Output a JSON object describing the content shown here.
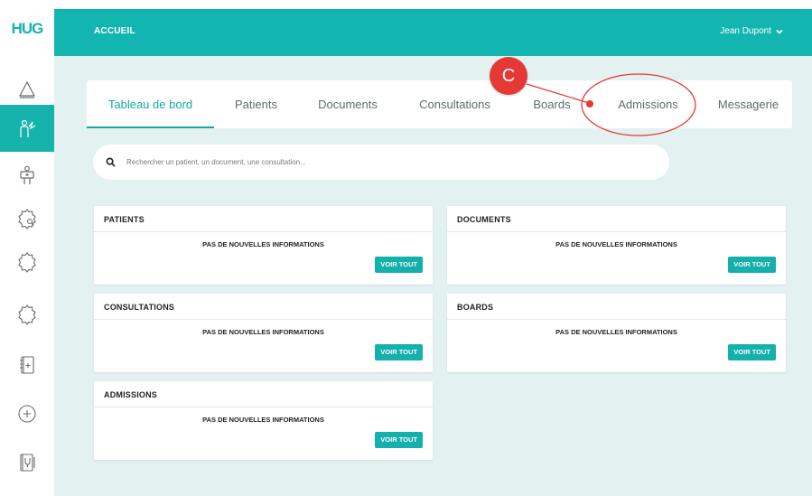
{
  "logo": {
    "text": "HUG"
  },
  "header": {
    "title": "ACCUEIL",
    "user_name": "Jean Dupont"
  },
  "sidebar": {
    "items": [
      {
        "icon": "home-icon"
      },
      {
        "icon": "doctor-icon",
        "active": true
      },
      {
        "icon": "patient-icon"
      },
      {
        "icon": "search-badge-icon"
      },
      {
        "icon": "badge-icon"
      },
      {
        "icon": "badge-outline-icon"
      },
      {
        "icon": "medical-file-icon"
      },
      {
        "icon": "plus-circle-icon"
      },
      {
        "icon": "stethoscope-file-icon"
      }
    ]
  },
  "tabs": [
    {
      "label": "Tableau de bord",
      "active": true
    },
    {
      "label": "Patients"
    },
    {
      "label": "Documents"
    },
    {
      "label": "Consultations"
    },
    {
      "label": "Boards"
    },
    {
      "label": "Admissions"
    },
    {
      "label": "Messagerie"
    }
  ],
  "search": {
    "placeholder": "Rechercher un patient, un document, une consultation..."
  },
  "cards": [
    {
      "title": "PATIENTS",
      "message": "PAS DE NOUVELLES INFORMATIONS",
      "button": "VOIR TOUT"
    },
    {
      "title": "DOCUMENTS",
      "message": "PAS DE NOUVELLES INFORMATIONS",
      "button": "VOIR TOUT"
    },
    {
      "title": "CONSULTATIONS",
      "message": "PAS DE NOUVELLES INFORMATIONS",
      "button": "VOIR TOUT"
    },
    {
      "title": "BOARDS",
      "message": "PAS DE NOUVELLES INFORMATIONS",
      "button": "VOIR TOUT"
    },
    {
      "title": "ADMISSIONS",
      "message": "PAS DE NOUVELLES INFORMATIONS",
      "button": "VOIR TOUT"
    }
  ],
  "annotation": {
    "label": "C",
    "color": "#e53935"
  },
  "colors": {
    "brand": "#12b5b0",
    "background": "#e4f1f1",
    "annotation": "#e53935"
  }
}
